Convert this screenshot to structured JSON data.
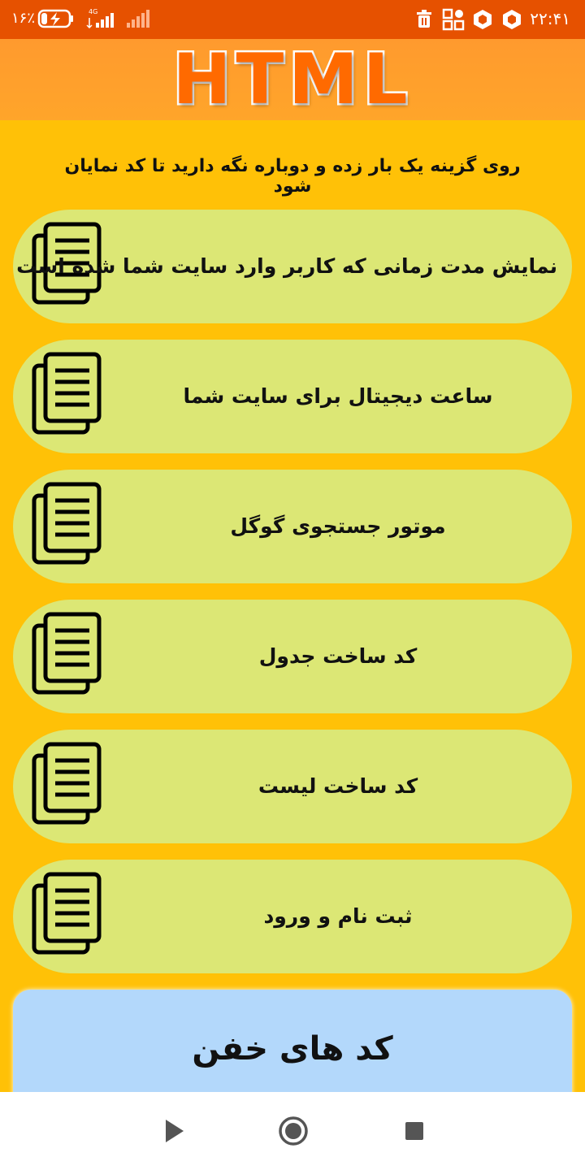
{
  "status_bar": {
    "battery_percent": "۱۶٪",
    "network_label": "4G",
    "time": "۲۲:۴۱",
    "icons": [
      "battery-charging-icon",
      "signal-4g-icon",
      "signal-icon",
      "trash-icon",
      "apps-icon",
      "hexagon-app-icon",
      "hexagon-app-icon"
    ]
  },
  "header": {
    "title": "HTML"
  },
  "instruction": "روی گزینه یک بار زده و دوباره  نگه دارید تا کد نمایان شود",
  "menu": {
    "items": [
      {
        "label": "نمایش مدت زمانی که کاربر وارد سایت شما شده است",
        "icon": "document-copy-icon"
      },
      {
        "label": "ساعت دیجیتال برای سایت شما",
        "icon": "document-copy-icon"
      },
      {
        "label": "موتور جستجوی گوگل",
        "icon": "document-copy-icon"
      },
      {
        "label": "کد ساخت جدول",
        "icon": "document-copy-icon"
      },
      {
        "label": "کد ساخت لیست",
        "icon": "document-copy-icon"
      },
      {
        "label": "ثبت نام و ورود",
        "icon": "document-copy-icon"
      }
    ]
  },
  "promo": {
    "label": "کد های خفن"
  },
  "nav": {
    "icons": [
      "back-play-icon",
      "home-circle-icon",
      "recents-square-icon"
    ]
  },
  "colors": {
    "status_bar": "#e65100",
    "header": "#ffa52a",
    "background": "#ffc107",
    "menu_item": "#dce775",
    "promo_card": "#b3d8fb"
  }
}
